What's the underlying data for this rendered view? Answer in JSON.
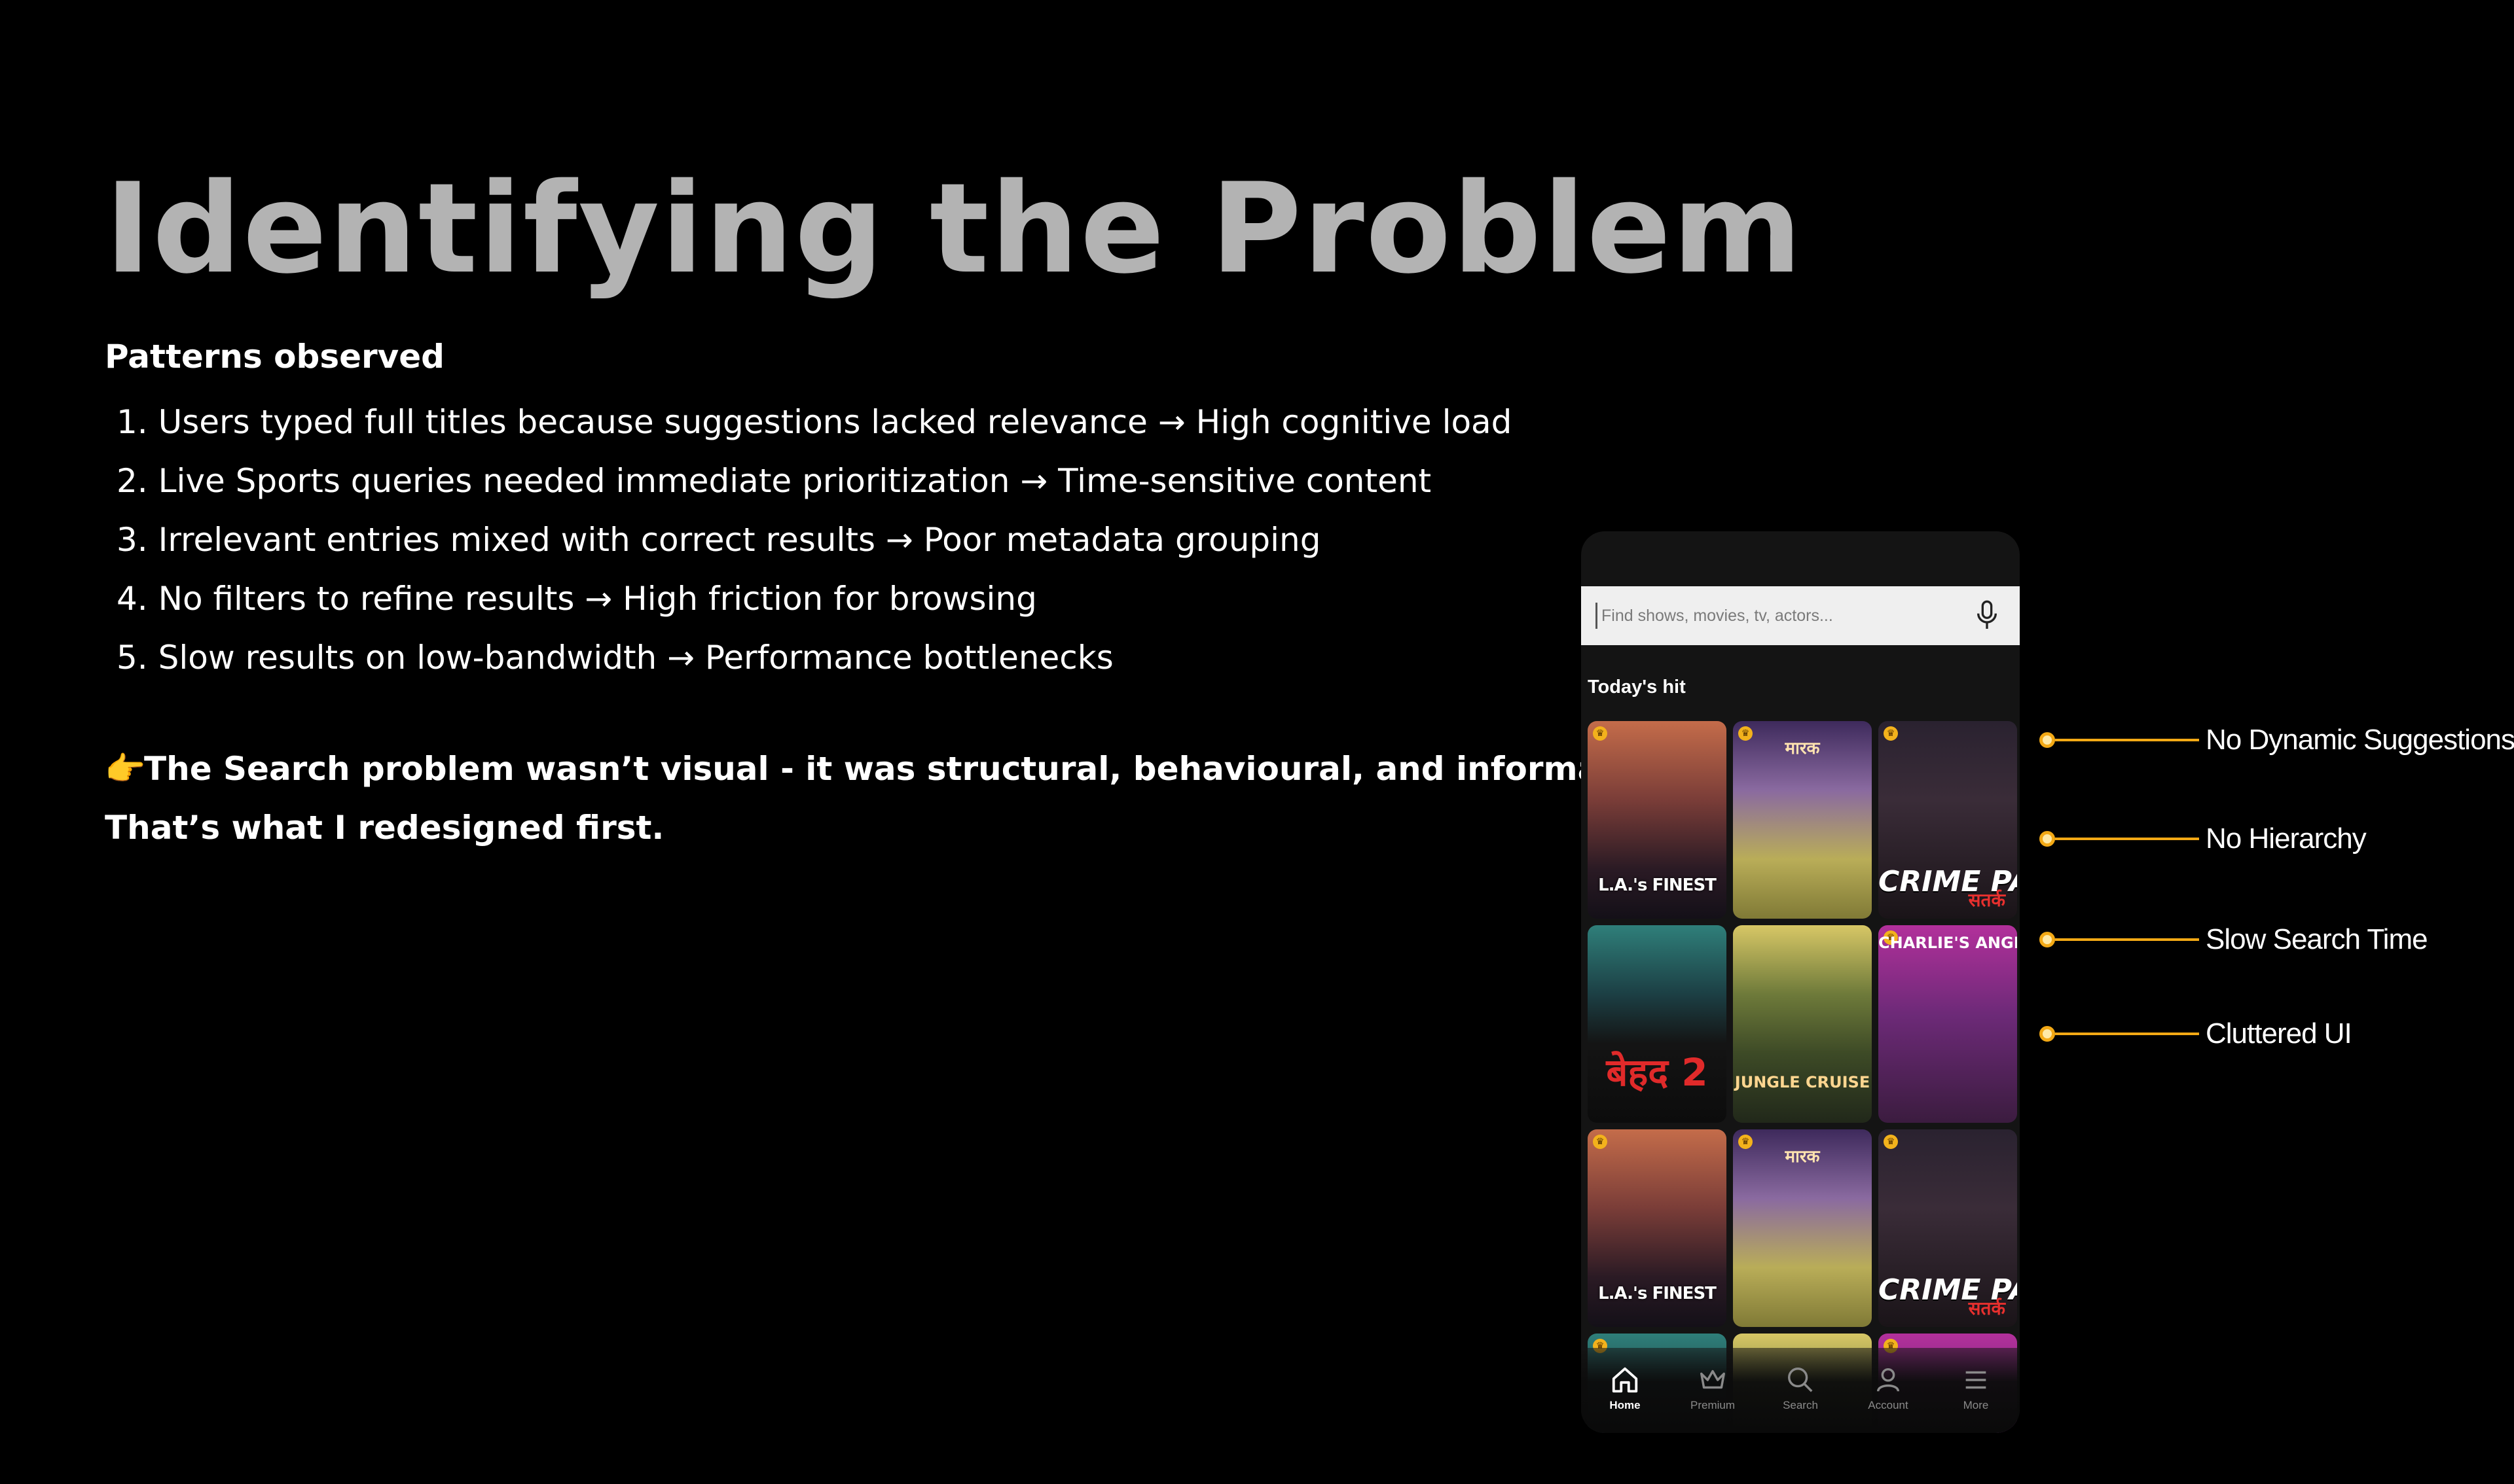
{
  "title": "Identifying the Problem",
  "patterns": {
    "heading": "Patterns observed",
    "items": [
      "Users typed full titles because suggestions lacked relevance → High cognitive load",
      "Live Sports queries needed immediate prioritization → Time-sensitive content",
      "Irrelevant entries mixed with correct results → Poor metadata grouping",
      "No filters to refine results → High friction for browsing",
      "Slow results on low-bandwidth → Performance bottlenecks"
    ],
    "numbers": [
      "1.",
      "2.",
      "3.",
      "4.",
      "5."
    ]
  },
  "conclusion": {
    "emoji": "👉",
    "line1": "The Search problem wasn’t visual - it was structural, behavioural, and informational.",
    "line2": "That’s what I redesigned first."
  },
  "phone": {
    "search_placeholder": "Find shows, movies, tv, actors...",
    "section_title": "Today's hit",
    "posters": [
      {
        "title": "L.A.'s FINEST",
        "variant": "lasfinest"
      },
      {
        "title": "मारक",
        "variant": "marak"
      },
      {
        "title": "CRIME PATROL",
        "sub": "सतर्क",
        "variant": "crime"
      },
      {
        "title": "बेहद 2",
        "variant": "bekaboo"
      },
      {
        "title": "JUNGLE CRUISE",
        "variant": "jungle"
      },
      {
        "title": "CHARLIE'S ANGELS",
        "variant": "charlies"
      },
      {
        "title": "L.A.'s FINEST",
        "variant": "lasfinest"
      },
      {
        "title": "मारक",
        "variant": "marak"
      },
      {
        "title": "CRIME PATROL",
        "sub": "सतर्क",
        "variant": "crime"
      }
    ],
    "nav": [
      {
        "label": "Home",
        "icon": "home-icon",
        "active": true
      },
      {
        "label": "Premium",
        "icon": "crown-icon",
        "active": false
      },
      {
        "label": "Search",
        "icon": "search-icon",
        "active": false
      },
      {
        "label": "Account",
        "icon": "account-icon",
        "active": false
      },
      {
        "label": "More",
        "icon": "menu-icon",
        "active": false
      }
    ]
  },
  "callouts": [
    "No Dynamic Suggestions",
    "No Hierarchy",
    "Slow Search Time",
    "Cluttered UI"
  ],
  "colors": {
    "background": "#000000",
    "title": "#b3b3b3",
    "text": "#ffffff",
    "accent": "#f3a915"
  }
}
